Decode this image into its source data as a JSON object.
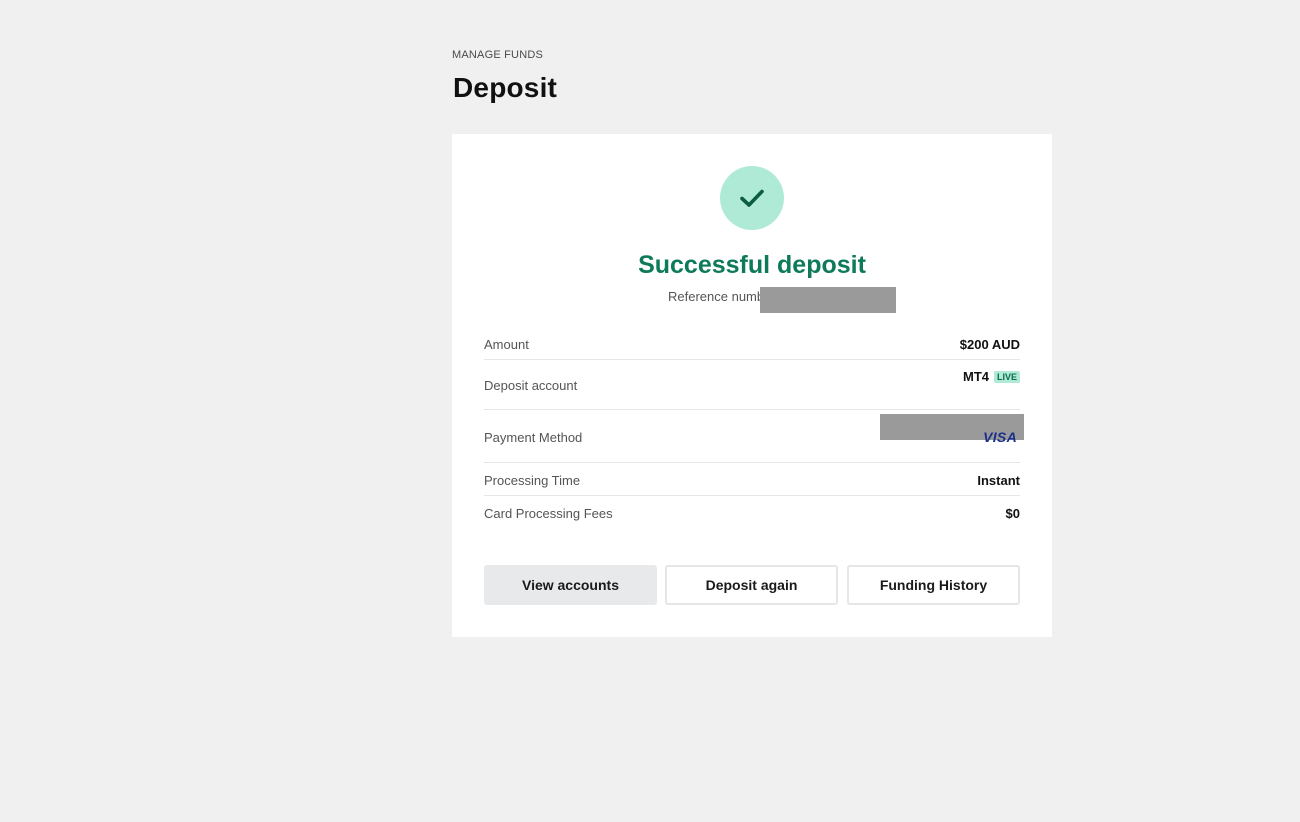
{
  "header": {
    "eyebrow": "MANAGE FUNDS",
    "title": "Deposit"
  },
  "result": {
    "icon": "checkmark-icon",
    "title": "Successful deposit",
    "reference_label": "Reference numb",
    "accent_color": "#0e7a5a",
    "icon_bg_color": "#aeead6"
  },
  "details": {
    "amount": {
      "label": "Amount",
      "value": "$200 AUD"
    },
    "deposit_account": {
      "label": "Deposit account",
      "value": "MT4",
      "badge": "LIVE"
    },
    "payment_method": {
      "label": "Payment Method",
      "value": "VISA"
    },
    "processing_time": {
      "label": "Processing Time",
      "value": "Instant"
    },
    "card_fees": {
      "label": "Card Processing Fees",
      "value": "$0"
    }
  },
  "actions": {
    "view_accounts": "View accounts",
    "deposit_again": "Deposit again",
    "funding_history": "Funding History"
  }
}
